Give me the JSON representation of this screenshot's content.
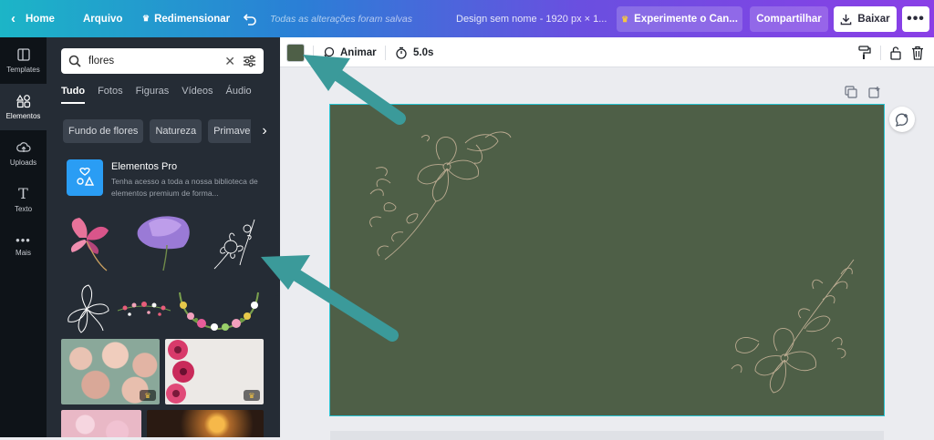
{
  "topbar": {
    "home": "Home",
    "file": "Arquivo",
    "resize": "Redimensionar",
    "saved_status": "Todas as alterações foram salvas",
    "design_title": "Design sem nome - 1920 px × 1...",
    "try_pro": "Experimente o Can...",
    "share": "Compartilhar",
    "download": "Baixar",
    "more": "•••"
  },
  "rail": {
    "items": [
      {
        "label": "Templates",
        "icon": "templates-icon"
      },
      {
        "label": "Elementos",
        "icon": "elements-icon"
      },
      {
        "label": "Uploads",
        "icon": "upload-icon"
      },
      {
        "label": "Texto",
        "icon": "text-icon"
      },
      {
        "label": "Mais",
        "icon": "more-icon"
      }
    ]
  },
  "panel": {
    "search_value": "flores",
    "tabs": [
      "Tudo",
      "Fotos",
      "Figuras",
      "Vídeos",
      "Áudio"
    ],
    "chips": [
      "Fundo de flores",
      "Natureza",
      "Primavera"
    ],
    "pro": {
      "title": "Elementos Pro",
      "description": "Tenha acesso a toda a nossa biblioteca de elementos premium de forma..."
    }
  },
  "toolbar": {
    "color_swatch": "#4e5f47",
    "animate": "Animar",
    "duration": "5.0s"
  },
  "colors": {
    "canvas_background": "#4e5f47",
    "selection_outline": "#27c4d3",
    "annotation_arrow": "#3b9a9a"
  }
}
